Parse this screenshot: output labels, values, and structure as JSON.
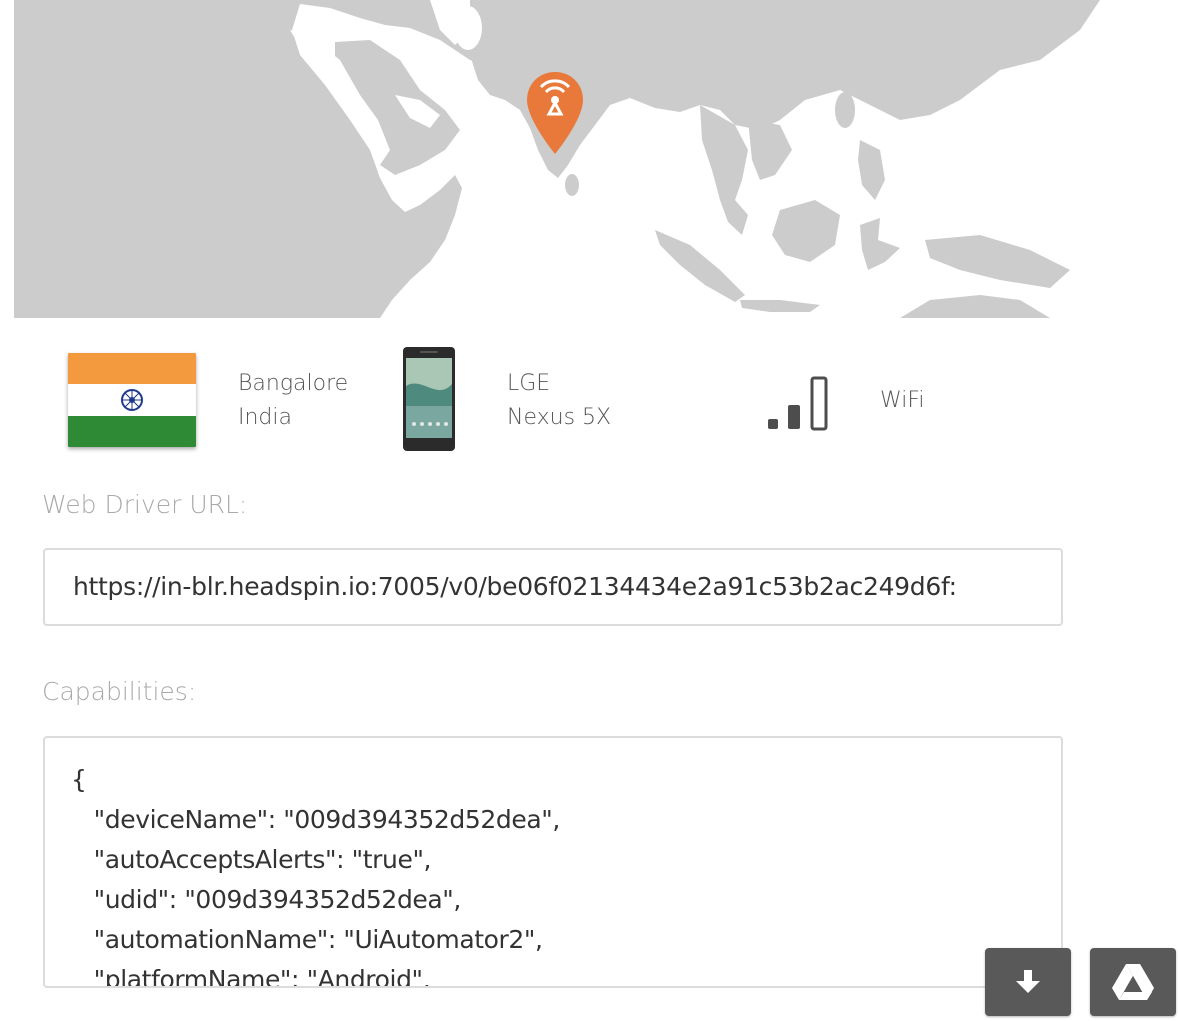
{
  "location": {
    "city": "Bangalore",
    "country": "India",
    "flag_icon": "india-flag-icon",
    "pin_icon": "radio-tower-pin-icon",
    "pin_color": "#e8793a"
  },
  "device": {
    "manufacturer": "LGE",
    "model": "Nexus 5X",
    "icon": "phone-icon"
  },
  "network": {
    "type": "WiFi",
    "icon": "signal-strength-icon"
  },
  "webdriver": {
    "label": "Web Driver URL:",
    "value": "https://in-blr.headspin.io:7005/v0/be06f02134434e2a91c53b2ac249d6f:"
  },
  "capabilities": {
    "label": "Capabilities:",
    "value": "{\n   \"deviceName\": \"009d394352d52dea\",\n   \"autoAcceptsAlerts\": \"true\",\n   \"udid\": \"009d394352d52dea\",\n   \"automationName\": \"UiAutomator2\",\n   \"platformName\": \"Android\","
  },
  "actions": {
    "download_icon": "download-arrow-icon",
    "drive_icon": "google-drive-icon",
    "button_color": "#595959"
  }
}
